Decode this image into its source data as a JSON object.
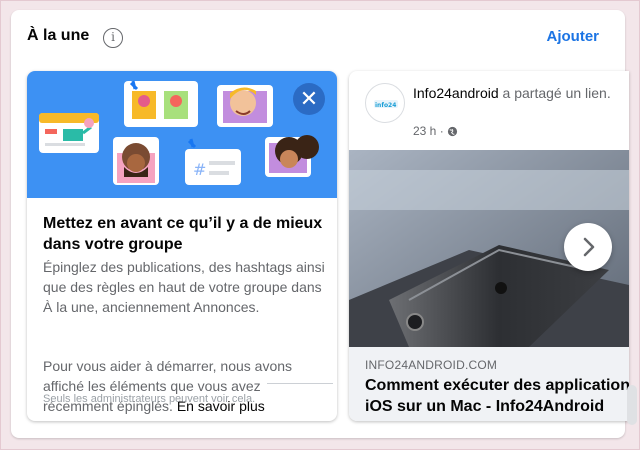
{
  "header": {
    "title": "À la une",
    "info_icon": "info-icon",
    "add_label": "Ajouter"
  },
  "featured_card": {
    "title": "Mettez en avant ce qu’il y a de mieux dans votre groupe",
    "description": "Épinglez des publications, des hashtags ainsi que des règles en haut de votre groupe dans À la une, anciennement Annonces.",
    "description_2_lines": [
      "Pour vous aider à démarrer, nous avons",
      "affiché les éléments que vous avez",
      "récemment épinglés."
    ],
    "learn_more_label": "En savoir plus",
    "footer_text": "Seuls les administrateurs peuvent voir cela.",
    "close_icon": "close-icon",
    "hero_color": "#3d91f3"
  },
  "post_card": {
    "author": "Info24android",
    "action": " a partagé un lien.",
    "time": "23 h · ",
    "privacy_icon": "globe-icon",
    "link_domain": "INFO24ANDROID.COM",
    "link_title_line1": "Comment exécuter des applications",
    "link_title_line2": "iOS sur un Mac - Info24Android",
    "next_icon": "chevron-right-icon"
  },
  "colors": {
    "accent": "#1b74e4",
    "text_primary": "#050505",
    "text_secondary": "#65676b"
  }
}
